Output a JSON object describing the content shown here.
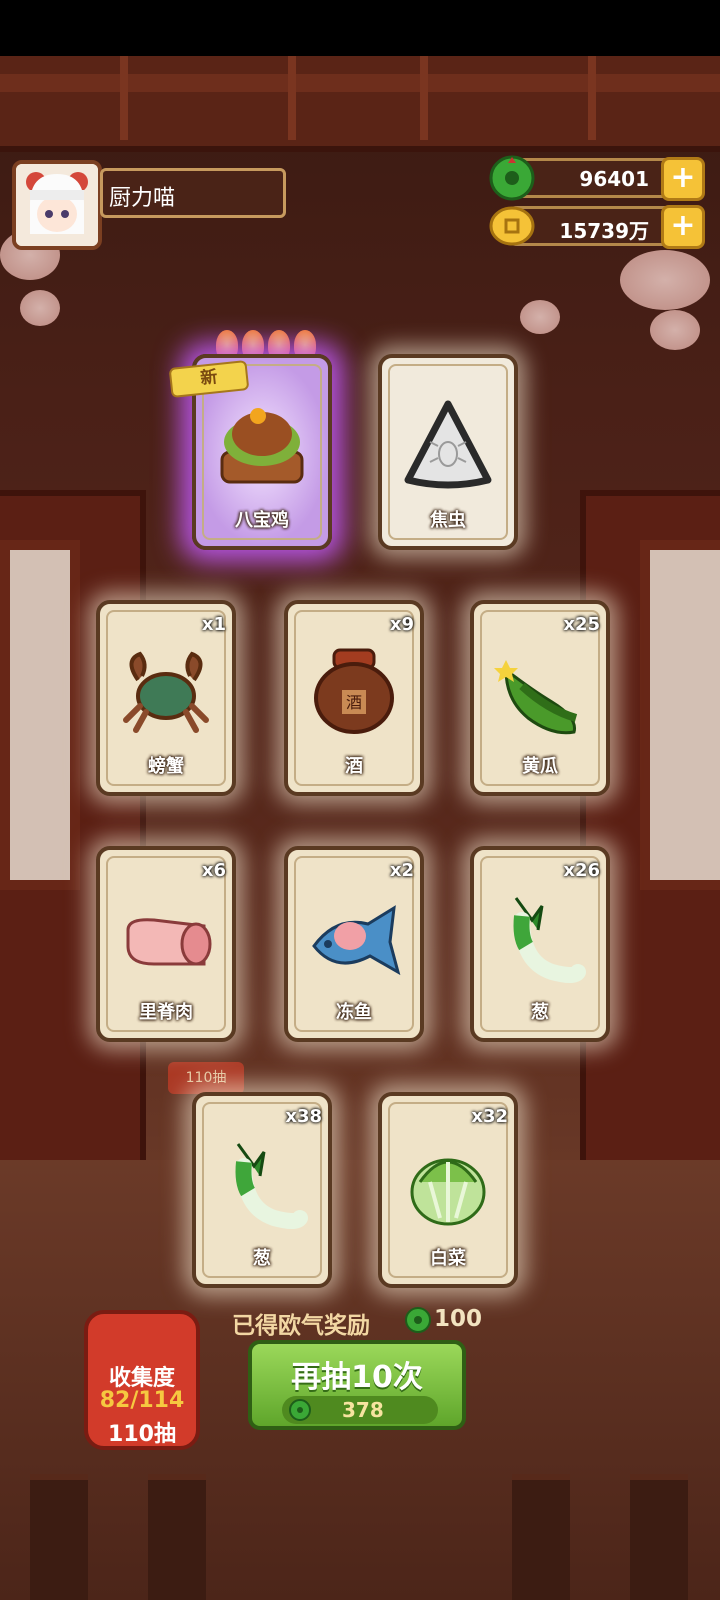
{
  "player": {
    "name": "厨力喵"
  },
  "resources": {
    "jade": {
      "value": "96401",
      "icon": "jade-coin-icon",
      "plus": "+"
    },
    "gold": {
      "value": "15739万",
      "icon": "gold-coin-icon",
      "plus": "+"
    }
  },
  "featured": [
    {
      "label": "八宝鸡",
      "badge": "新",
      "stars": 4,
      "icon": "roast-chicken-basket-icon",
      "rarity": "purple"
    },
    {
      "label": "焦虫",
      "icon": "bug-triangle-icon",
      "rarity": "normal"
    }
  ],
  "cards": [
    {
      "label": "螃蟹",
      "count": "x1",
      "icon": "crab-icon"
    },
    {
      "label": "酒",
      "count": "x9",
      "icon": "wine-jar-icon",
      "jar_text": "酒"
    },
    {
      "label": "黄瓜",
      "count": "x25",
      "icon": "cucumber-icon"
    },
    {
      "label": "里脊肉",
      "count": "x6",
      "icon": "pork-loin-icon"
    },
    {
      "label": "冻鱼",
      "count": "x2",
      "icon": "frozen-fish-icon"
    },
    {
      "label": "葱",
      "count": "x26",
      "icon": "scallion-icon"
    },
    {
      "label": "葱",
      "count": "x38",
      "icon": "scallion-icon"
    },
    {
      "label": "白菜",
      "count": "x32",
      "icon": "cabbage-icon"
    }
  ],
  "reward": {
    "text": "已得欧气奖励",
    "amount": "100",
    "icon": "jade-coin-icon"
  },
  "collection": {
    "title": "收集度",
    "progress": "82/114",
    "draws": "110抽"
  },
  "background_badge": "110抽",
  "draw_button": {
    "label": "再抽10次",
    "cost": "378",
    "cost_icon": "jade-coin-icon"
  },
  "colors": {
    "jade": "#3aa836",
    "gold": "#f5c237",
    "button": "#6fb835",
    "rare_glow": "#c45cff",
    "card_bg": "#efe3c8"
  }
}
